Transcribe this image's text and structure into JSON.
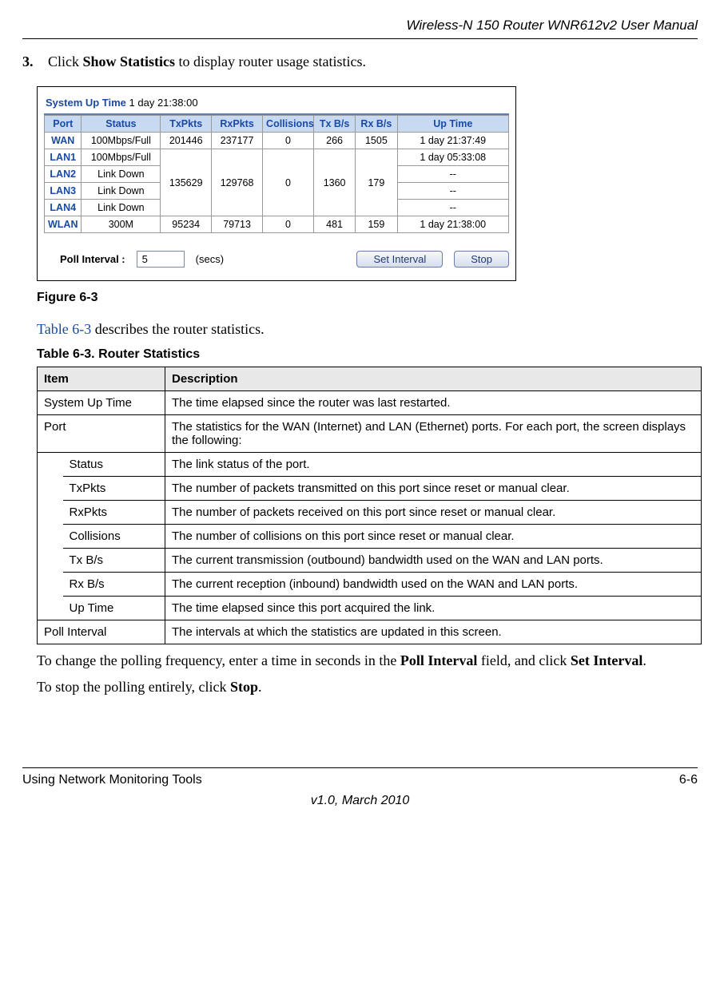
{
  "header": {
    "title": "Wireless-N 150 Router WNR612v2 User Manual"
  },
  "step": {
    "num": "3.",
    "pre": "Click ",
    "bold": "Show Statistics",
    "post": " to display router usage statistics."
  },
  "figure": {
    "sysup_label": "System Up Time",
    "sysup_value": " 1 day 21:38:00",
    "headers": [
      "Port",
      "Status",
      "TxPkts",
      "RxPkts",
      "Collisions",
      "Tx B/s",
      "Rx B/s",
      "Up Time"
    ],
    "rows": {
      "wan": {
        "port": "WAN",
        "status": "100Mbps/Full",
        "tx": "201446",
        "rx": "237177",
        "coll": "0",
        "txbs": "266",
        "rxbs": "1505",
        "up": "1 day 21:37:49"
      },
      "lan1": {
        "port": "LAN1",
        "status": "100Mbps/Full",
        "up": "1 day 05:33:08"
      },
      "lan2": {
        "port": "LAN2",
        "status": "Link Down",
        "up": "--"
      },
      "lan3": {
        "port": "LAN3",
        "status": "Link Down",
        "up": "--"
      },
      "lan4": {
        "port": "LAN4",
        "status": "Link Down",
        "up": "--"
      },
      "lan_group": {
        "tx": "135629",
        "rx": "129768",
        "coll": "0",
        "txbs": "1360",
        "rxbs": "179"
      },
      "wlan": {
        "port": "WLAN",
        "status": "300M",
        "tx": "95234",
        "rx": "79713",
        "coll": "0",
        "txbs": "481",
        "rxbs": "159",
        "up": "1 day 21:38:00"
      }
    },
    "poll": {
      "label": "Poll Interval :",
      "value": "5",
      "secs": "(secs)",
      "set": "Set Interval",
      "stop": "Stop"
    },
    "caption": "Figure 6-3"
  },
  "ref": {
    "link": "Table 6-3",
    "rest": " describes the router statistics."
  },
  "table": {
    "caption": "Table 6-3. Router Statistics",
    "head_item": "Item",
    "head_desc": "Description",
    "rows": [
      {
        "item": "System Up Time",
        "desc": "The time elapsed since the router was last restarted."
      },
      {
        "item": "Port",
        "desc": "The statistics for the WAN (Internet) and LAN (Ethernet) ports. For each port, the screen displays the following:"
      }
    ],
    "subrows": [
      {
        "item": "Status",
        "desc": "The link status of the port."
      },
      {
        "item": "TxPkts",
        "desc": "The number of packets transmitted on this port since reset or manual clear."
      },
      {
        "item": "RxPkts",
        "desc": "The number of packets received on this port since reset or manual clear."
      },
      {
        "item": "Collisions",
        "desc": "The number of collisions on this port since reset or manual clear."
      },
      {
        "item": "Tx B/s",
        "desc": "The current transmission (outbound) bandwidth used on the WAN and LAN ports."
      },
      {
        "item": "Rx B/s",
        "desc": "The current reception (inbound) bandwidth used on the WAN and LAN ports."
      },
      {
        "item": "Up Time",
        "desc": "The time elapsed since this port acquired the link."
      }
    ],
    "last": {
      "item": "Poll Interval",
      "desc": "The intervals at which the statistics are updated in this screen."
    }
  },
  "para1": {
    "pre": "To change the polling frequency, enter a time in seconds in the ",
    "b1": "Poll Interval",
    "mid": " field, and click ",
    "b2": "Set Interval",
    "post": "."
  },
  "para2": {
    "pre": "To stop the polling entirely, click ",
    "b1": "Stop",
    "post": "."
  },
  "footer": {
    "left": "Using Network Monitoring Tools",
    "right": "6-6",
    "center": "v1.0, March 2010"
  }
}
